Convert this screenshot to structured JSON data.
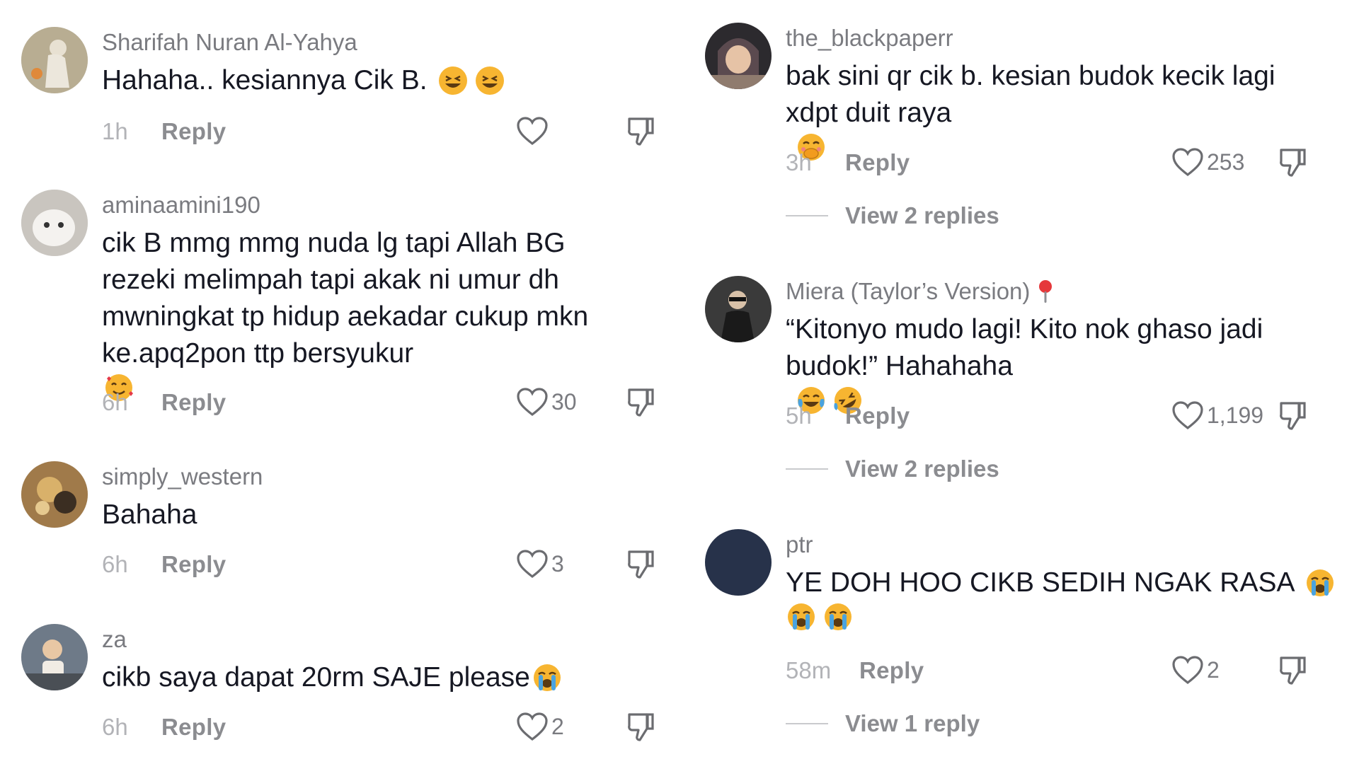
{
  "left_comments": [
    {
      "username": "Sharifah Nuran Al-Yahya",
      "text": "Hahaha.. kesiannya Cik B.",
      "emojis": [
        "grinning-squint",
        "grinning-squint"
      ],
      "time": "1h",
      "reply_label": "Reply",
      "likes": ""
    },
    {
      "username": "aminaamini190",
      "text": "cik B mmg mmg nuda lg tapi Allah BG rezeki melimpah tapi akak ni umur dh mwningkat tp hidup aekadar cukup mkn ke.apq2pon ttp bersyukur",
      "emojis": [
        "smiling-hearts"
      ],
      "time": "6h",
      "reply_label": "Reply",
      "likes": "30"
    },
    {
      "username": "simply_western",
      "text": "Bahaha",
      "emojis": [],
      "time": "6h",
      "reply_label": "Reply",
      "likes": "3"
    },
    {
      "username": "za",
      "text": "cikb saya dapat 20rm SAJE please",
      "emojis": [
        "loudly-crying"
      ],
      "time": "6h",
      "reply_label": "Reply",
      "likes": "2"
    }
  ],
  "right_comments": [
    {
      "username": "the_blackpaperr",
      "text": "bak sini qr cik b. kesian budok kecik lagi xdpt duit raya",
      "emojis": [
        "face-hand-over-mouth"
      ],
      "time": "3h",
      "reply_label": "Reply",
      "likes": "253",
      "view_replies": "View 2 replies"
    },
    {
      "username": "Miera (Taylor’s Version)",
      "username_icon": "pin-icon",
      "text": "“Kitonyo mudo lagi! Kito nok ghaso jadi budok!” Hahahaha",
      "emojis": [
        "tears-of-joy",
        "rolling-laughing"
      ],
      "time": "5h",
      "reply_label": "Reply",
      "likes": "1,199",
      "view_replies": "View 2 replies"
    },
    {
      "username": "ptr",
      "text": "YE DOH HOO CIKB SEDIH NGAK RASA",
      "emojis": [
        "loudly-crying",
        "loudly-crying",
        "loudly-crying"
      ],
      "time": "58m",
      "reply_label": "Reply",
      "likes": "2",
      "view_replies": "View 1 reply"
    }
  ],
  "colors": {
    "text": "#161823",
    "muted": "#7a7b80",
    "faint": "#b2b3b7",
    "emoji": "#f7b531"
  }
}
